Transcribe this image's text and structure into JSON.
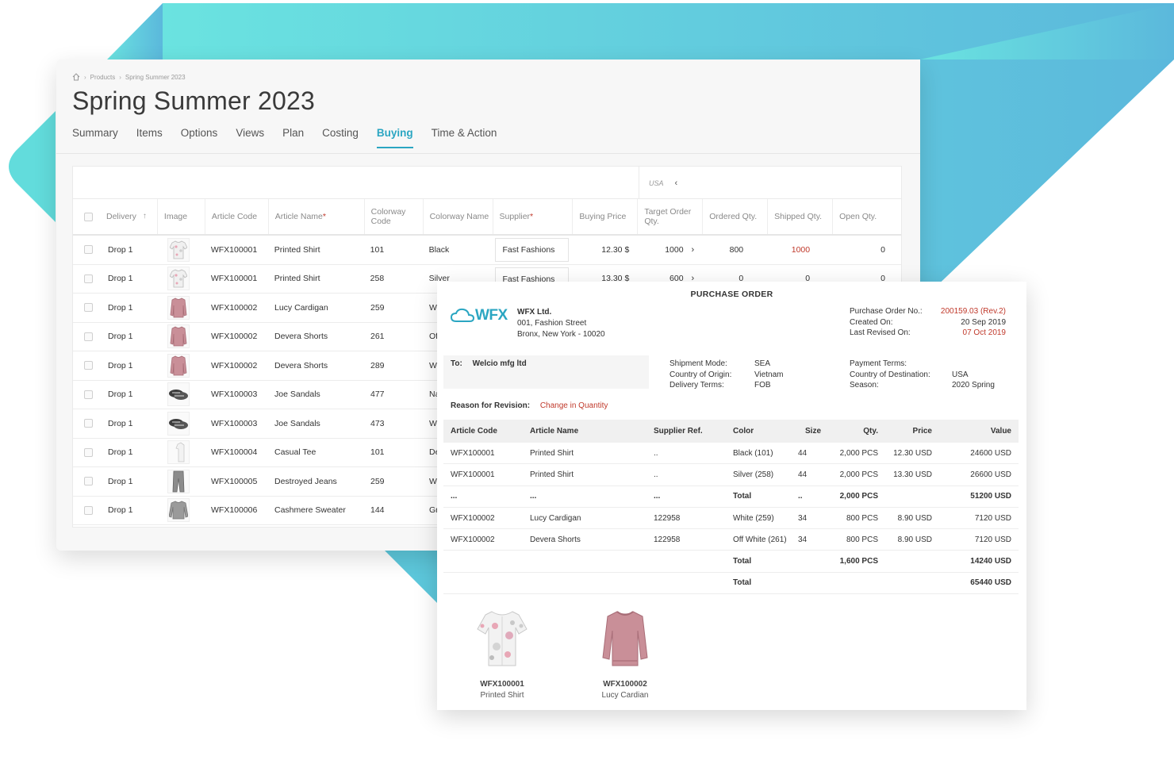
{
  "breadcrumb": [
    "Products",
    "Spring Summer 2023"
  ],
  "page_title": "Spring Summer 2023",
  "tabs": [
    {
      "label": "Summary"
    },
    {
      "label": "Items"
    },
    {
      "label": "Options"
    },
    {
      "label": "Views"
    },
    {
      "label": "Plan"
    },
    {
      "label": "Costing"
    },
    {
      "label": "Buying",
      "active": true
    },
    {
      "label": "Time & Action"
    }
  ],
  "grid": {
    "region": "USA",
    "headers": {
      "delivery": "Delivery",
      "image": "Image",
      "article_code": "Article Code",
      "article_name": "Article Name",
      "colorway_code": "Colorway Code",
      "colorway_name": "Colorway Name",
      "supplier": "Supplier",
      "buying_price": "Buying Price",
      "target_qty": "Target Order Qty.",
      "ordered_qty": "Ordered Qty.",
      "shipped_qty": "Shipped Qty.",
      "open_qty": "Open Qty."
    },
    "rows": [
      {
        "delivery": "Drop 1",
        "image": "shirt-thumbnail",
        "code": "WFX100001",
        "name": "Printed Shirt",
        "cw_code": "101",
        "cw_name": "Black",
        "supplier": "Fast Fashions",
        "price": "12.30 $",
        "target": "1000",
        "ordered": "800",
        "shipped": "1000",
        "open": "0"
      },
      {
        "delivery": "Drop 1",
        "image": "shirt-thumbnail",
        "code": "WFX100001",
        "name": "Printed Shirt",
        "cw_code": "258",
        "cw_name": "Silver",
        "supplier": "Fast Fashions",
        "price": "13.30 $",
        "target": "600",
        "ordered": "0",
        "shipped": "0",
        "open": "0"
      },
      {
        "delivery": "Drop 1",
        "image": "cardigan-thumbnail",
        "code": "WFX100002",
        "name": "Lucy Cardigan",
        "cw_code": "259",
        "cw_name": "W"
      },
      {
        "delivery": "Drop 1",
        "image": "cardigan-thumbnail",
        "code": "WFX100002",
        "name": "Devera Shorts",
        "cw_code": "261",
        "cw_name": "Of"
      },
      {
        "delivery": "Drop 1",
        "image": "cardigan-thumbnail",
        "code": "WFX100002",
        "name": "Devera Shorts",
        "cw_code": "289",
        "cw_name": "W"
      },
      {
        "delivery": "Drop 1",
        "image": "sandals-thumbnail",
        "code": "WFX100003",
        "name": "Joe Sandals",
        "cw_code": "477",
        "cw_name": "Na"
      },
      {
        "delivery": "Drop 1",
        "image": "sandals-thumbnail",
        "code": "WFX100003",
        "name": "Joe Sandals",
        "cw_code": "473",
        "cw_name": "W"
      },
      {
        "delivery": "Drop 1",
        "image": "tee-thumbnail",
        "code": "WFX100004",
        "name": "Casual Tee",
        "cw_code": "101",
        "cw_name": "De"
      },
      {
        "delivery": "Drop 1",
        "image": "jeans-thumbnail",
        "code": "WFX100005",
        "name": "Destroyed Jeans",
        "cw_code": "259",
        "cw_name": "W"
      },
      {
        "delivery": "Drop 1",
        "image": "sweater-thumbnail",
        "code": "WFX100006",
        "name": "Cashmere Sweater",
        "cw_code": "144",
        "cw_name": "Gr"
      }
    ]
  },
  "po": {
    "title": "PURCHASE ORDER",
    "logo_text": "WFX",
    "company": {
      "name": "WFX Ltd.",
      "address1": "001, Fashion Street",
      "address2": "Bronx, New York - 10020"
    },
    "meta": [
      {
        "label": "Purchase Order No.:",
        "value": "200159.03 (Rev.2)",
        "highlight": true
      },
      {
        "label": "Created On:",
        "value": "20 Sep 2019",
        "highlight": false
      },
      {
        "label": "Last Revised On:",
        "value": "07 Oct 2019",
        "highlight": true
      }
    ],
    "to_label": "To:",
    "to_value": "Welcio mfg ltd",
    "shipment": [
      {
        "label": "Shipment Mode:",
        "value": "SEA"
      },
      {
        "label": "Country of Origin:",
        "value": "Vietnam"
      },
      {
        "label": "Delivery Terms:",
        "value": "FOB"
      }
    ],
    "payment": [
      {
        "label": "Payment Terms:",
        "value": ""
      },
      {
        "label": "Country of Destination:",
        "value": "USA"
      },
      {
        "label": "Season:",
        "value": "2020 Spring"
      }
    ],
    "reason_label": "Reason for Revision:",
    "reason_value": "Change in Quantity",
    "table_headers": [
      "Article Code",
      "Article Name",
      "Supplier Ref.",
      "Color",
      "Size",
      "Qty.",
      "Price",
      "Value"
    ],
    "table_rows": [
      [
        "WFX100001",
        "Printed Shirt",
        "..",
        "Black (101)",
        "44",
        "2,000 PCS",
        "12.30 USD",
        "24600 USD"
      ],
      [
        "WFX100001",
        "Printed Shirt",
        "..",
        "Silver (258)",
        "44",
        "2,000 PCS",
        "13.30 USD",
        "26600 USD"
      ],
      [
        "...",
        "...",
        "...",
        "Total",
        "..",
        "2,000 PCS",
        "",
        "51200 USD"
      ],
      [
        "WFX100002",
        "Lucy Cardigan",
        "122958",
        "White (259)",
        "34",
        "800 PCS",
        "8.90 USD",
        "7120 USD"
      ],
      [
        "WFX100002",
        "Devera Shorts",
        "122958",
        "Off White (261)",
        "34",
        "800 PCS",
        "8.90 USD",
        "7120 USD"
      ],
      [
        "",
        "",
        "",
        "Total",
        "",
        "1,600 PCS",
        "",
        "14240 USD"
      ],
      [
        "",
        "",
        "",
        "Total",
        "",
        "",
        "",
        "65440 USD"
      ]
    ],
    "items": [
      {
        "code": "WFX100001",
        "name": "Printed Shirt",
        "image": "printed-shirt-image"
      },
      {
        "code": "WFX100002",
        "name": "Lucy Cardian",
        "image": "cardigan-image"
      }
    ]
  },
  "colors": {
    "accent": "#2ba6c2",
    "highlight_red": "#c0392b",
    "bg_gradient_start": "#6ae3e0",
    "bg_gradient_end": "#5bb8dc"
  }
}
